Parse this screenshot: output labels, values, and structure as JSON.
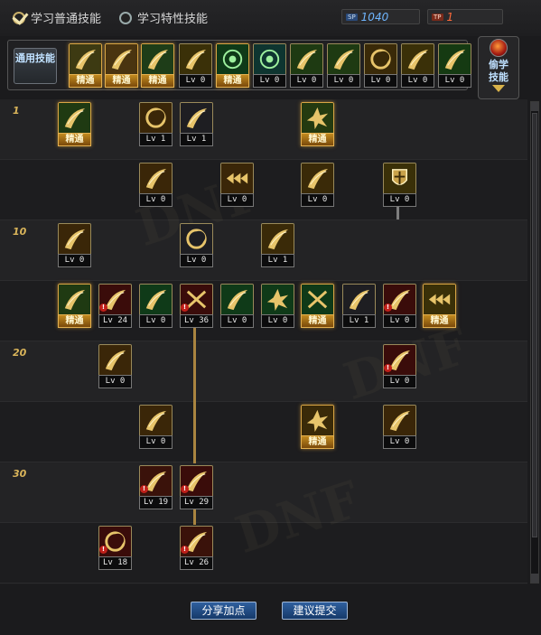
{
  "tabs": [
    {
      "label": "学习普通技能",
      "selected": true
    },
    {
      "label": "学习特性技能",
      "selected": false
    }
  ],
  "points": {
    "sp_tag": "SP",
    "sp_value": "1040",
    "tp_tag": "TP",
    "tp_value": "1"
  },
  "common": {
    "title": "通用技能",
    "skills": [
      {
        "icon": "kick-icon",
        "caption": "精通",
        "master": true,
        "color": "#3d3a12"
      },
      {
        "icon": "crouch-icon",
        "caption": "精通",
        "master": true,
        "color": "#4a3410"
      },
      {
        "icon": "dash-icon",
        "caption": "精通",
        "master": true,
        "color": "#1e3d18"
      },
      {
        "icon": "wings-icon",
        "caption": "Lv 0",
        "master": false,
        "color": "#3a3008"
      },
      {
        "icon": "target-green-icon",
        "caption": "精通",
        "master": true,
        "color": "#0f3a18"
      },
      {
        "icon": "target-teal-icon",
        "caption": "Lv 0",
        "master": false,
        "color": "#0e3530"
      },
      {
        "icon": "soldier-icon",
        "caption": "Lv 0",
        "master": false,
        "color": "#1e3a12"
      },
      {
        "icon": "soldier-run-icon",
        "caption": "Lv 0",
        "master": false,
        "color": "#1e3a12"
      },
      {
        "icon": "eye-icon",
        "caption": "Lv 0",
        "master": false,
        "color": "#3a2a08"
      },
      {
        "icon": "muscle-icon",
        "caption": "Lv 0",
        "master": false,
        "color": "#3a3008"
      },
      {
        "icon": "figure-green-icon",
        "caption": "Lv 0",
        "master": false,
        "color": "#153a12"
      }
    ]
  },
  "extra": {
    "label": "偷学技能"
  },
  "level_labels": [
    "1",
    "10",
    "20",
    "30"
  ],
  "tree": [
    {
      "icon": "slash-text-icon",
      "caption": "精通",
      "master": true,
      "color": "#1f3a12"
    },
    {
      "icon": "crescent-slash-icon",
      "caption": "Lv 1",
      "master": false,
      "color": "#3a2608"
    },
    {
      "icon": "arc-slash-icon",
      "caption": "Lv 1",
      "master": false,
      "color": "#1e1e22"
    },
    {
      "icon": "sword-burst-icon",
      "caption": "精通",
      "master": true,
      "color": "#243a10"
    },
    {
      "icon": "spark-slash-icon",
      "caption": "Lv 0",
      "master": false,
      "color": "#3a2608"
    },
    {
      "icon": "triple-arrow-icon",
      "caption": "Lv 0",
      "master": false,
      "color": "#3a2608"
    },
    {
      "icon": "ground-wave-icon",
      "caption": "Lv 0",
      "master": false,
      "color": "#3a2a08"
    },
    {
      "icon": "shield-icon",
      "caption": "Lv 0",
      "master": false,
      "color": "#3a3008"
    },
    {
      "icon": "lightning-slash-icon",
      "caption": "Lv 0",
      "master": false,
      "color": "#3a2608"
    },
    {
      "icon": "dark-ring-icon",
      "caption": "Lv 0",
      "master": false,
      "color": "#1e1e22"
    },
    {
      "icon": "beast-icon",
      "caption": "Lv 1",
      "master": false,
      "color": "#3a2a08"
    },
    {
      "icon": "fist-icon",
      "caption": "精通",
      "master": true,
      "color": "#1f3a12"
    },
    {
      "icon": "red-blade-icon",
      "caption": "Lv 24",
      "master": false,
      "color": "#3a0c0a",
      "req": true
    },
    {
      "icon": "green-slash-icon",
      "caption": "Lv 0",
      "master": false,
      "color": "#0f3a18"
    },
    {
      "icon": "red-cross-icon",
      "caption": "Lv 36",
      "master": false,
      "color": "#3a0c0a",
      "req": true
    },
    {
      "icon": "green-block-icon",
      "caption": "Lv 0",
      "master": false,
      "color": "#0f3a18"
    },
    {
      "icon": "green-burst-icon",
      "caption": "Lv 0",
      "master": false,
      "color": "#0f3a18"
    },
    {
      "icon": "green-cross-icon",
      "caption": "精通",
      "master": true,
      "color": "#0f3a18"
    },
    {
      "icon": "curve-slash-icon",
      "caption": "Lv 1",
      "master": false,
      "color": "#1e1e22"
    },
    {
      "icon": "red-figure-icon",
      "caption": "Lv 0",
      "master": false,
      "color": "#3a0c0a",
      "req": true
    },
    {
      "icon": "gold-arrows-icon",
      "caption": "精通",
      "master": true,
      "color": "#3a3008"
    },
    {
      "icon": "swoosh-icon",
      "caption": "Lv 0",
      "master": false,
      "color": "#3a2608"
    },
    {
      "icon": "red-pillar-icon",
      "caption": "Lv 0",
      "master": false,
      "color": "#3a0c0a",
      "req": true
    },
    {
      "icon": "wing-slash-icon",
      "caption": "Lv 0",
      "master": false,
      "color": "#3a2608"
    },
    {
      "icon": "gold-explosion-icon",
      "caption": "精通",
      "master": true,
      "color": "#3a2a08"
    },
    {
      "icon": "claw-icon",
      "caption": "Lv 0",
      "master": false,
      "color": "#3a2608"
    },
    {
      "icon": "flame-slash-icon",
      "caption": "Lv 19",
      "master": false,
      "color": "#3a120a",
      "req": true
    },
    {
      "icon": "sword-stance-icon",
      "caption": "Lv 29",
      "master": false,
      "color": "#3a0c0a",
      "req": true
    },
    {
      "icon": "red-crescent-icon",
      "caption": "Lv 18",
      "master": false,
      "color": "#3a0c0a",
      "req": true
    },
    {
      "icon": "fire-wing-icon",
      "caption": "Lv 26",
      "master": false,
      "color": "#3a120a",
      "req": true
    }
  ],
  "buttons": {
    "share": "分享加点",
    "submit": "建议提交"
  }
}
